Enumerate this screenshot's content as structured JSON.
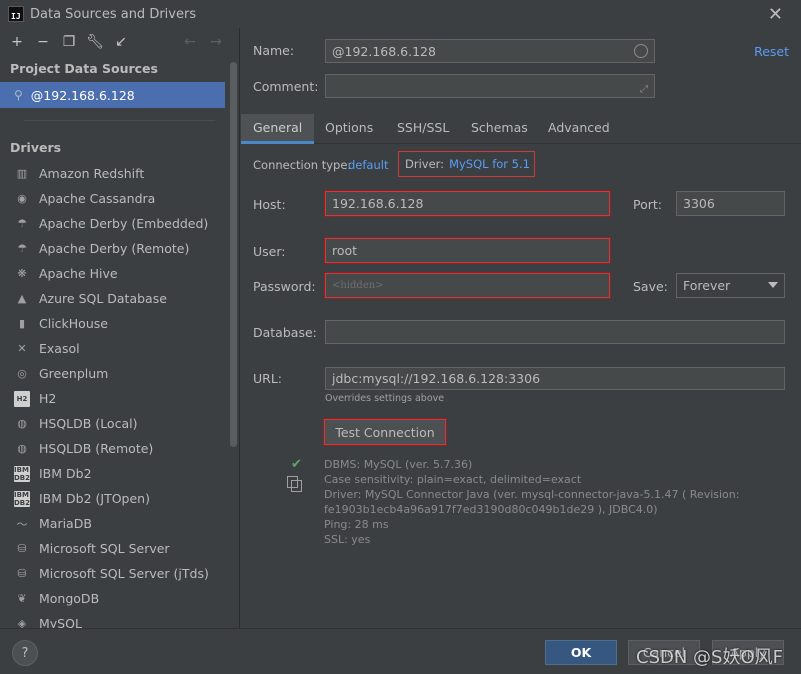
{
  "window": {
    "title": "Data Sources and Drivers",
    "logo_text": "IJ"
  },
  "left": {
    "project_section": "Project Data Sources",
    "project_item": "@192.168.6.128",
    "drivers_section": "Drivers",
    "drivers": [
      {
        "label": "Amazon Redshift",
        "icon": "redshift-icon"
      },
      {
        "label": "Apache Cassandra",
        "icon": "cassandra-icon"
      },
      {
        "label": "Apache Derby (Embedded)",
        "icon": "derby-icon"
      },
      {
        "label": "Apache Derby (Remote)",
        "icon": "derby-icon"
      },
      {
        "label": "Apache Hive",
        "icon": "hive-icon"
      },
      {
        "label": "Azure SQL Database",
        "icon": "azure-icon"
      },
      {
        "label": "ClickHouse",
        "icon": "clickhouse-icon"
      },
      {
        "label": "Exasol",
        "icon": "exasol-icon"
      },
      {
        "label": "Greenplum",
        "icon": "greenplum-icon"
      },
      {
        "label": "H2",
        "icon": "h2-icon",
        "badge": "H2"
      },
      {
        "label": "HSQLDB (Local)",
        "icon": "hsqldb-icon"
      },
      {
        "label": "HSQLDB (Remote)",
        "icon": "hsqldb-icon"
      },
      {
        "label": "IBM Db2",
        "icon": "ibm-icon",
        "badge": "IBM DB2"
      },
      {
        "label": "IBM Db2 (JTOpen)",
        "icon": "ibm-icon",
        "badge": "IBM DB2"
      },
      {
        "label": "MariaDB",
        "icon": "mariadb-icon"
      },
      {
        "label": "Microsoft SQL Server",
        "icon": "mssql-icon"
      },
      {
        "label": "Microsoft SQL Server (jTds)",
        "icon": "mssql-icon"
      },
      {
        "label": "MongoDB",
        "icon": "mongodb-icon"
      },
      {
        "label": "MySQL",
        "icon": "mysql-icon"
      }
    ]
  },
  "form": {
    "name_label": "Name:",
    "name_value": "@192.168.6.128",
    "reset_label": "Reset",
    "comment_label": "Comment:",
    "comment_value": "",
    "tabs": [
      "General",
      "Options",
      "SSH/SSL",
      "Schemas",
      "Advanced"
    ],
    "conn_type_label": "Connection type:",
    "conn_type_value": "default",
    "driver_label": "Driver:",
    "driver_value": "MySQL for 5.1",
    "host_label": "Host:",
    "host_value": "192.168.6.128",
    "port_label": "Port:",
    "port_value": "3306",
    "user_label": "User:",
    "user_value": "root",
    "password_label": "Password:",
    "password_placeholder": "<hidden>",
    "save_label": "Save:",
    "save_value": "Forever",
    "database_label": "Database:",
    "database_value": "",
    "url_label": "URL:",
    "url_value": "jdbc:mysql://192.168.6.128:3306",
    "url_hint": "Overrides settings above",
    "test_button": "Test Connection"
  },
  "result": {
    "lines": [
      "DBMS: MySQL (ver. 5.7.36)",
      "Case sensitivity: plain=exact, delimited=exact",
      "Driver: MySQL Connector Java (ver. mysql-connector-java-5.1.47 ( Revision:",
      "fe1903b1ecb4a96a917f7ed3190d80c049b1de29 ), JDBC4.0)",
      "Ping: 28 ms",
      "SSL: yes"
    ]
  },
  "footer": {
    "help": "?",
    "ok": "OK",
    "cancel": "Cancel",
    "apply": "Apply",
    "watermark": "CSDN @S妖O风F"
  },
  "colors": {
    "accent": "#4a88c7",
    "link": "#589df6",
    "highlight_border": "#d0393b",
    "selection": "#4b6eaf"
  }
}
